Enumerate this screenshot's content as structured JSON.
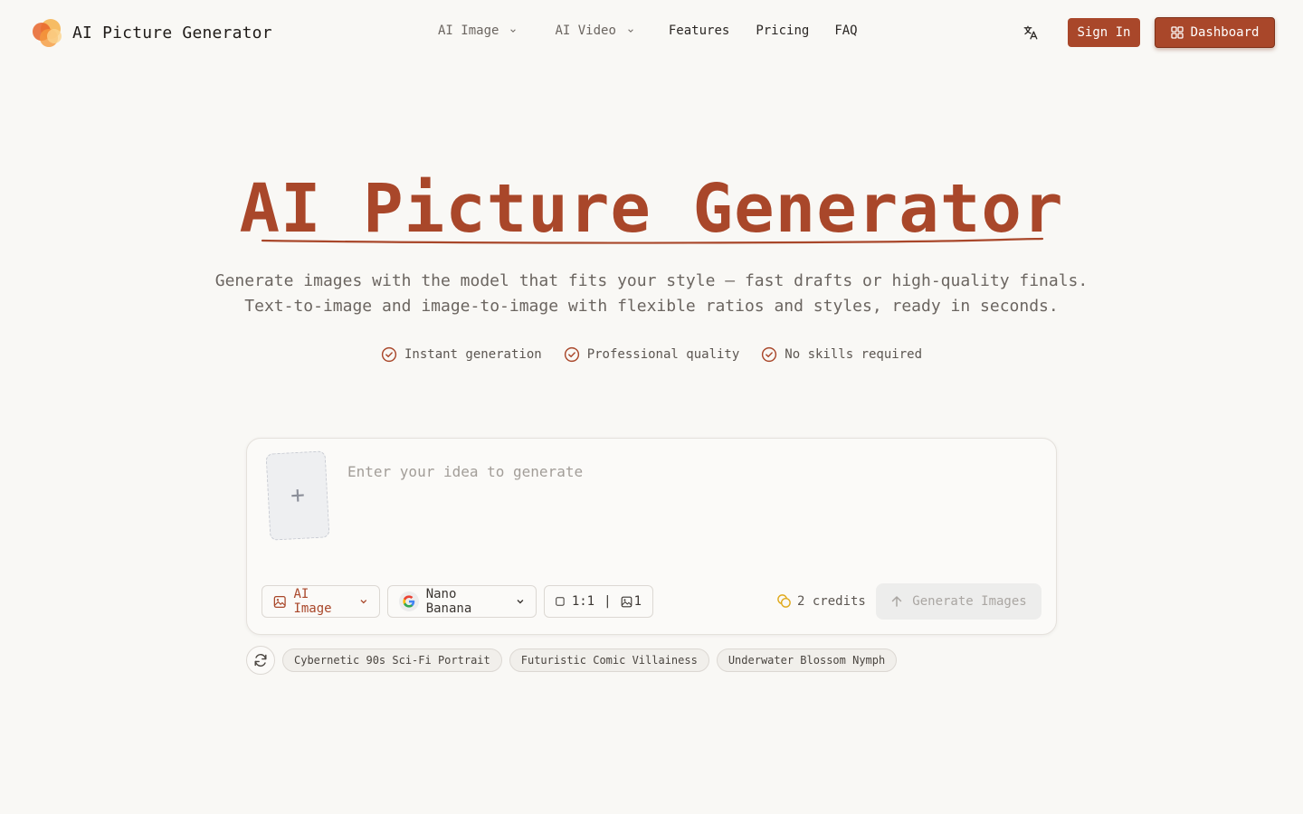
{
  "header": {
    "brand_name": "AI Picture Generator",
    "nav": [
      {
        "label": "AI Image",
        "dropdown": true
      },
      {
        "label": "AI Video",
        "dropdown": true
      },
      {
        "label": "Features",
        "dropdown": false
      },
      {
        "label": "Pricing",
        "dropdown": false
      },
      {
        "label": "FAQ",
        "dropdown": false
      }
    ],
    "language_icon": "translate-icon",
    "sign_in_label": "Sign In",
    "dashboard_label": "Dashboard",
    "dashboard_icon": "grid-icon"
  },
  "hero": {
    "title": "AI Picture Generator",
    "subtitle_line1": "Generate images with the model that fits your style — fast drafts or high-quality finals.",
    "subtitle_line2": "Text-to-image and image-to-image with flexible ratios and styles, ready in seconds.",
    "perks": [
      "Instant generation",
      "Professional quality",
      "No skills required"
    ]
  },
  "generator": {
    "upload_icon": "plus-icon",
    "prompt_placeholder": "Enter your idea to generate",
    "prompt_value": "",
    "type_select": "AI Image",
    "model_select": "Nano Banana",
    "ratio": "1:1",
    "ratio_separator": "|",
    "image_count": "1",
    "credits": "2 credits",
    "generate_label": "Generate Images"
  },
  "suggestions": {
    "refresh_icon": "refresh-icon",
    "items": [
      "Cybernetic 90s Sci-Fi Portrait",
      "Futuristic Comic Villainess",
      "Underwater Blossom Nymph"
    ]
  },
  "colors": {
    "accent": "#a9472a",
    "background": "#f9f8f5"
  }
}
